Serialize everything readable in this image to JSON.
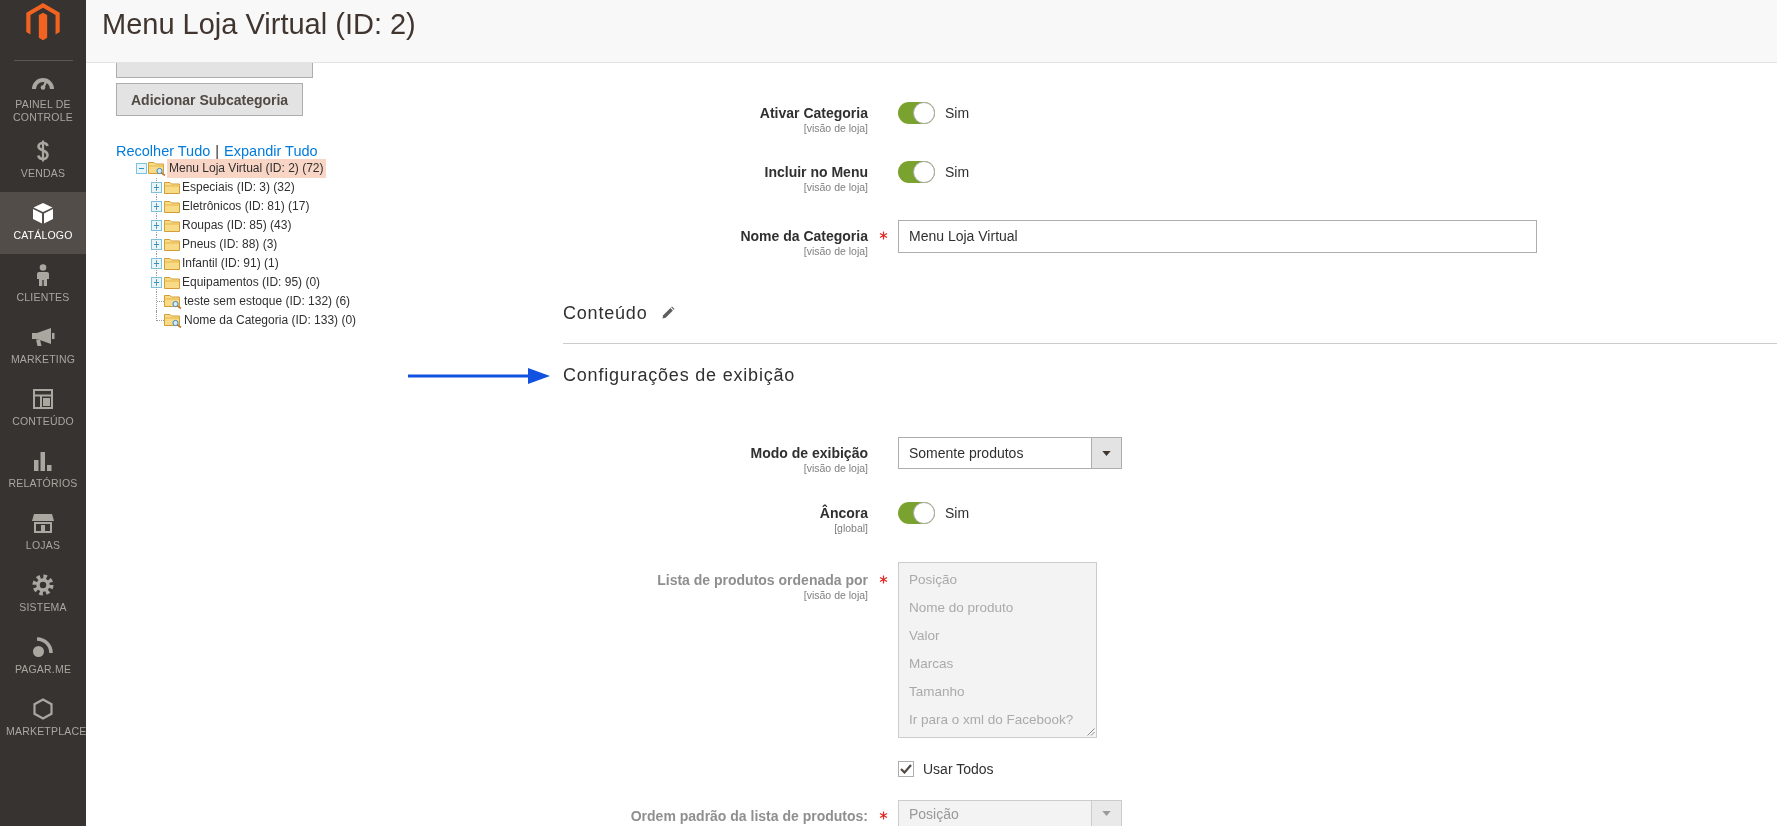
{
  "sidebar": {
    "items": [
      {
        "label": "PAINEL DE CONTROLE",
        "selected": false
      },
      {
        "label": "VENDAS",
        "selected": false
      },
      {
        "label": "CATÁLOGO",
        "selected": true
      },
      {
        "label": "CLIENTES",
        "selected": false
      },
      {
        "label": "MARKETING",
        "selected": false
      },
      {
        "label": "CONTEÚDO",
        "selected": false
      },
      {
        "label": "RELATÓRIOS",
        "selected": false
      },
      {
        "label": "LOJAS",
        "selected": false
      },
      {
        "label": "SISTEMA",
        "selected": false
      },
      {
        "label": "PAGAR.ME",
        "selected": false
      },
      {
        "label": "MARKETPLACE",
        "selected": false
      }
    ]
  },
  "header": {
    "title": "Menu Loja Virtual (ID: 2)"
  },
  "tree_panel": {
    "buttons": [
      "Adicionar Subcategoria"
    ],
    "links": [
      "Recolher Tudo",
      "Expandir Tudo"
    ],
    "link_separator": "|",
    "tree": [
      {
        "label": "Menu Loja Virtual (ID: 2) (72)",
        "kind": "root",
        "expanded": true,
        "selected": true,
        "children": [
          {
            "label": "Especiais (ID: 3) (32)",
            "kind": "branch",
            "expanded": false,
            "selected": false
          },
          {
            "label": "Eletrônicos (ID: 81) (17)",
            "kind": "branch",
            "expanded": false,
            "selected": false
          },
          {
            "label": "Roupas (ID: 85) (43)",
            "kind": "branch",
            "expanded": false,
            "selected": false
          },
          {
            "label": "Pneus (ID: 88) (3)",
            "kind": "branch",
            "expanded": false,
            "selected": false
          },
          {
            "label": "Infantil (ID: 91) (1)",
            "kind": "branch",
            "expanded": false,
            "selected": false
          },
          {
            "label": "Equipamentos (ID: 95) (0)",
            "kind": "branch",
            "expanded": false,
            "selected": false
          },
          {
            "label": "teste sem estoque (ID: 132) (6)",
            "kind": "leaf",
            "selected": false
          },
          {
            "label": "Nome da Categoria (ID: 133) (0)",
            "kind": "leaf",
            "selected": false
          }
        ]
      }
    ]
  },
  "form": {
    "fields": [
      {
        "kind": "toggle",
        "label": "Ativar Categoria",
        "scope": "[visão de loja]",
        "required": false,
        "disabled": false,
        "on": true,
        "value": "Sim"
      },
      {
        "kind": "toggle",
        "label": "Incluir no Menu",
        "scope": "[visão de loja]",
        "required": false,
        "disabled": false,
        "on": true,
        "value": "Sim"
      },
      {
        "kind": "text",
        "label": "Nome da Categoria",
        "scope": "[visão de loja]",
        "required": true,
        "disabled": false,
        "value": "Menu Loja Virtual"
      }
    ],
    "sections": [
      {
        "title": "Conteúdo",
        "expanded": false,
        "edited": true
      },
      {
        "title": "Configurações de exibição",
        "expanded": true,
        "edited": false,
        "fields": [
          {
            "kind": "select",
            "label": "Modo de exibição",
            "scope": "[visão de loja]",
            "required": false,
            "disabled": false,
            "value": "Somente produtos"
          },
          {
            "kind": "toggle",
            "label": "Âncora",
            "scope": "[global]",
            "required": false,
            "disabled": false,
            "on": true,
            "value": "Sim"
          },
          {
            "kind": "multiselect",
            "label": "Lista de produtos ordenada por",
            "scope": "[visão de loja]",
            "required": true,
            "disabled": true,
            "options": [
              "Posição",
              "Nome do produto",
              "Valor",
              "Marcas",
              "Tamanho",
              "Ir para o xml do Facebook?"
            ],
            "use_all": {
              "label": "Usar Todos",
              "checked": true
            }
          },
          {
            "kind": "select",
            "label": "Ordem padrão da lista de produtos:",
            "required": true,
            "disabled": true,
            "value": "Posição"
          }
        ]
      }
    ]
  }
}
